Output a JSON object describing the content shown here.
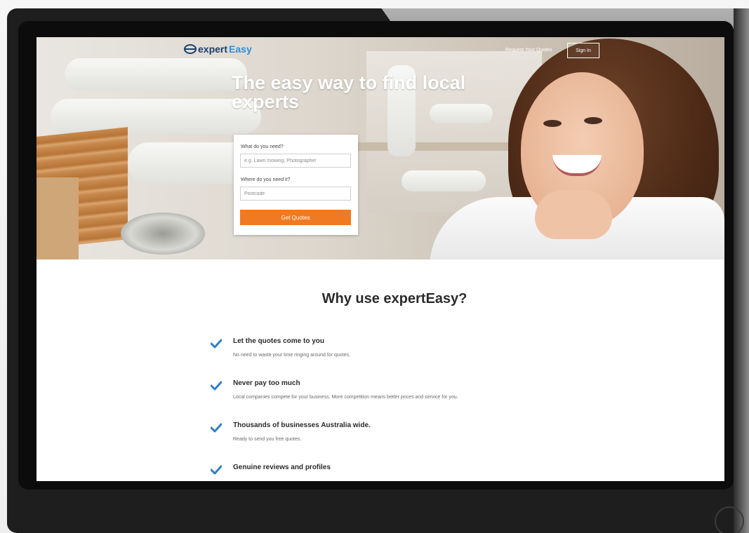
{
  "header": {
    "logo_part1": "expert",
    "logo_part2": "Easy",
    "nav_link": "Request Your Quotes",
    "signin_label": "Sign In"
  },
  "hero": {
    "title": "The easy way to find local experts"
  },
  "form": {
    "need_label": "What do you need?",
    "need_placeholder": "e.g. Lawn mowing, Photographer",
    "where_label": "Where do you need it?",
    "where_placeholder": "Postcode",
    "submit_label": "Get Quotes"
  },
  "benefits": {
    "title": "Why use expertEasy?",
    "items": [
      {
        "title": "Let the quotes come to you",
        "desc": "No need to waste your time ringing around for quotes."
      },
      {
        "title": "Never pay too much",
        "desc": "Local companies compete for your business. More competition means better prices and service for you."
      },
      {
        "title": "Thousands of businesses Australia wide.",
        "desc": "Ready to send you free quotes."
      },
      {
        "title": "Genuine reviews and profiles",
        "desc": ""
      }
    ]
  },
  "colors": {
    "brand_dark": "#1b3f6b",
    "brand_light": "#2f8fd6",
    "cta": "#f07a22",
    "check": "#2f7fc7"
  }
}
